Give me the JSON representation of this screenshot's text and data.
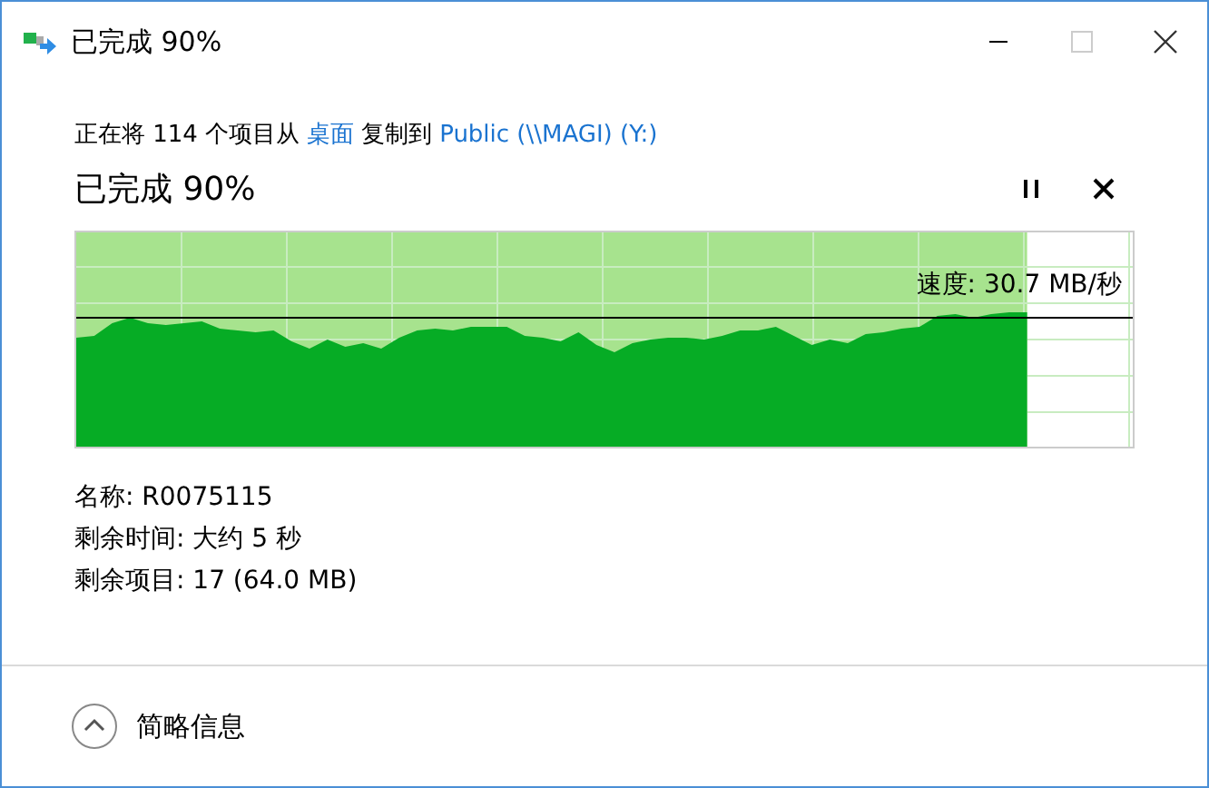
{
  "window": {
    "title": "已完成 90%"
  },
  "copy_line": {
    "prefix": "正在将 114 个项目从",
    "source": "桌面",
    "middle": "复制到",
    "destination": "Public (\\\\MAGI) (Y:)"
  },
  "heading": "已完成 90%",
  "progress": {
    "level": 0.9,
    "speed": "速度: 30.7 MB/秒"
  },
  "details": [
    "名称: R0075115",
    "剩余时间: 大约 5 秒",
    "剩余项目: 17 (64.0 MB)"
  ],
  "footer": {
    "toggle": "简略信息",
    "expanded": true
  }
}
